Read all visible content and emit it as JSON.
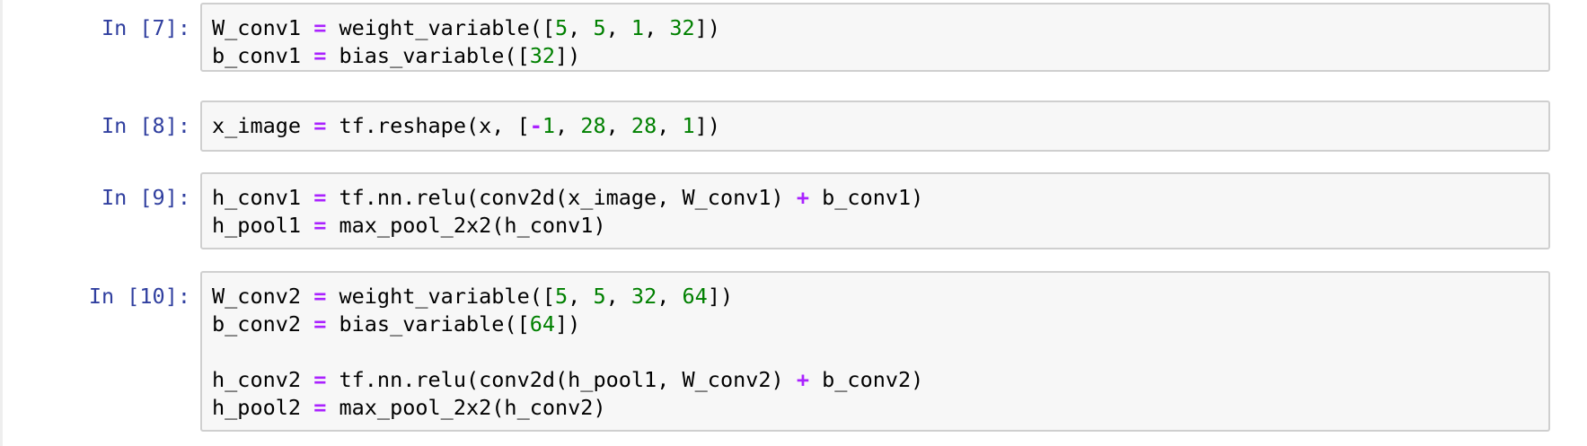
{
  "notebook": {
    "cells": [
      {
        "prompt": "In [7]:",
        "lines": [
          [
            {
              "t": "W_conv1 "
            },
            {
              "t": "=",
              "c": "op"
            },
            {
              "t": " weight_variable(["
            },
            {
              "t": "5",
              "c": "num"
            },
            {
              "t": ", "
            },
            {
              "t": "5",
              "c": "num"
            },
            {
              "t": ", "
            },
            {
              "t": "1",
              "c": "num"
            },
            {
              "t": ", "
            },
            {
              "t": "32",
              "c": "num"
            },
            {
              "t": "])"
            }
          ],
          [
            {
              "t": "b_conv1 "
            },
            {
              "t": "=",
              "c": "op"
            },
            {
              "t": " bias_variable(["
            },
            {
              "t": "32",
              "c": "num"
            },
            {
              "t": "])"
            }
          ]
        ]
      },
      {
        "prompt": "In [8]:",
        "lines": [
          [
            {
              "t": "x_image "
            },
            {
              "t": "=",
              "c": "op"
            },
            {
              "t": " tf.reshape(x, ["
            },
            {
              "t": "-",
              "c": "op"
            },
            {
              "t": "1",
              "c": "num"
            },
            {
              "t": ", "
            },
            {
              "t": "28",
              "c": "num"
            },
            {
              "t": ", "
            },
            {
              "t": "28",
              "c": "num"
            },
            {
              "t": ", "
            },
            {
              "t": "1",
              "c": "num"
            },
            {
              "t": "])"
            }
          ]
        ]
      },
      {
        "prompt": "In [9]:",
        "lines": [
          [
            {
              "t": "h_conv1 "
            },
            {
              "t": "=",
              "c": "op"
            },
            {
              "t": " tf.nn.relu(conv2d(x_image, W_conv1) "
            },
            {
              "t": "+",
              "c": "op"
            },
            {
              "t": " b_conv1)"
            }
          ],
          [
            {
              "t": "h_pool1 "
            },
            {
              "t": "=",
              "c": "op"
            },
            {
              "t": " max_pool_2x2(h_conv1)"
            }
          ]
        ]
      },
      {
        "prompt": "In [10]:",
        "lines": [
          [
            {
              "t": "W_conv2 "
            },
            {
              "t": "=",
              "c": "op"
            },
            {
              "t": " weight_variable(["
            },
            {
              "t": "5",
              "c": "num"
            },
            {
              "t": ", "
            },
            {
              "t": "5",
              "c": "num"
            },
            {
              "t": ", "
            },
            {
              "t": "32",
              "c": "num"
            },
            {
              "t": ", "
            },
            {
              "t": "64",
              "c": "num"
            },
            {
              "t": "])"
            }
          ],
          [
            {
              "t": "b_conv2 "
            },
            {
              "t": "=",
              "c": "op"
            },
            {
              "t": " bias_variable(["
            },
            {
              "t": "64",
              "c": "num"
            },
            {
              "t": "])"
            }
          ],
          [],
          [
            {
              "t": "h_conv2 "
            },
            {
              "t": "=",
              "c": "op"
            },
            {
              "t": " tf.nn.relu(conv2d(h_pool1, W_conv2) "
            },
            {
              "t": "+",
              "c": "op"
            },
            {
              "t": " b_conv2)"
            }
          ],
          [
            {
              "t": "h_pool2 "
            },
            {
              "t": "=",
              "c": "op"
            },
            {
              "t": " max_pool_2x2(h_conv2)"
            }
          ]
        ]
      }
    ]
  },
  "colors": {
    "prompt": "#303f9f",
    "operator": "#aa22ff",
    "number": "#008000",
    "cell_background": "#f7f7f7",
    "cell_border": "#cfcfcf"
  }
}
